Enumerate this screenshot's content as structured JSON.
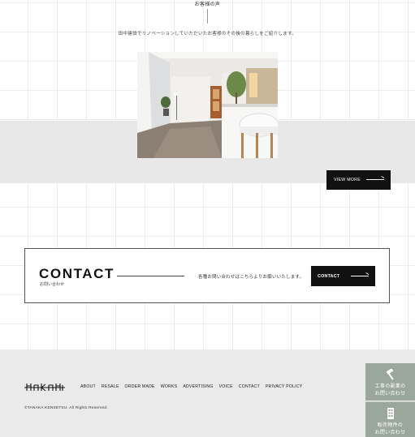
{
  "voice": {
    "heading": "お客様の声",
    "intro": "田中建設でリノベーションしていただいたお客様のその後の暮らしをご紹介します。",
    "view_more": "VIEW MORE"
  },
  "contact": {
    "title": "CONTACT",
    "subtitle": "お問い合わせ",
    "text": "各種お問い合わせはこちらよりお願いいたします。",
    "button": "CONTACT"
  },
  "footer": {
    "nav": [
      "ABOUT",
      "RESALE",
      "ORDER MADE",
      "WORKS",
      "ADVERTISING",
      "VOICE",
      "CONTACT",
      "PRIVACY POLICY"
    ],
    "copyright": "©TANAKA KENSETSU. All Rights Reserved."
  },
  "side_buttons": [
    {
      "line1": "工事の副業の",
      "line2": "お問い合わせ",
      "icon": "hammer-icon"
    },
    {
      "line1": "販売物件の",
      "line2": "お問い合わせ",
      "icon": "building-icon"
    }
  ],
  "colors": {
    "accent_dark": "#111111",
    "band_gray": "#e8e8e8",
    "footer_gray": "#eaeaea",
    "side_button_green": "#9aa79a"
  }
}
